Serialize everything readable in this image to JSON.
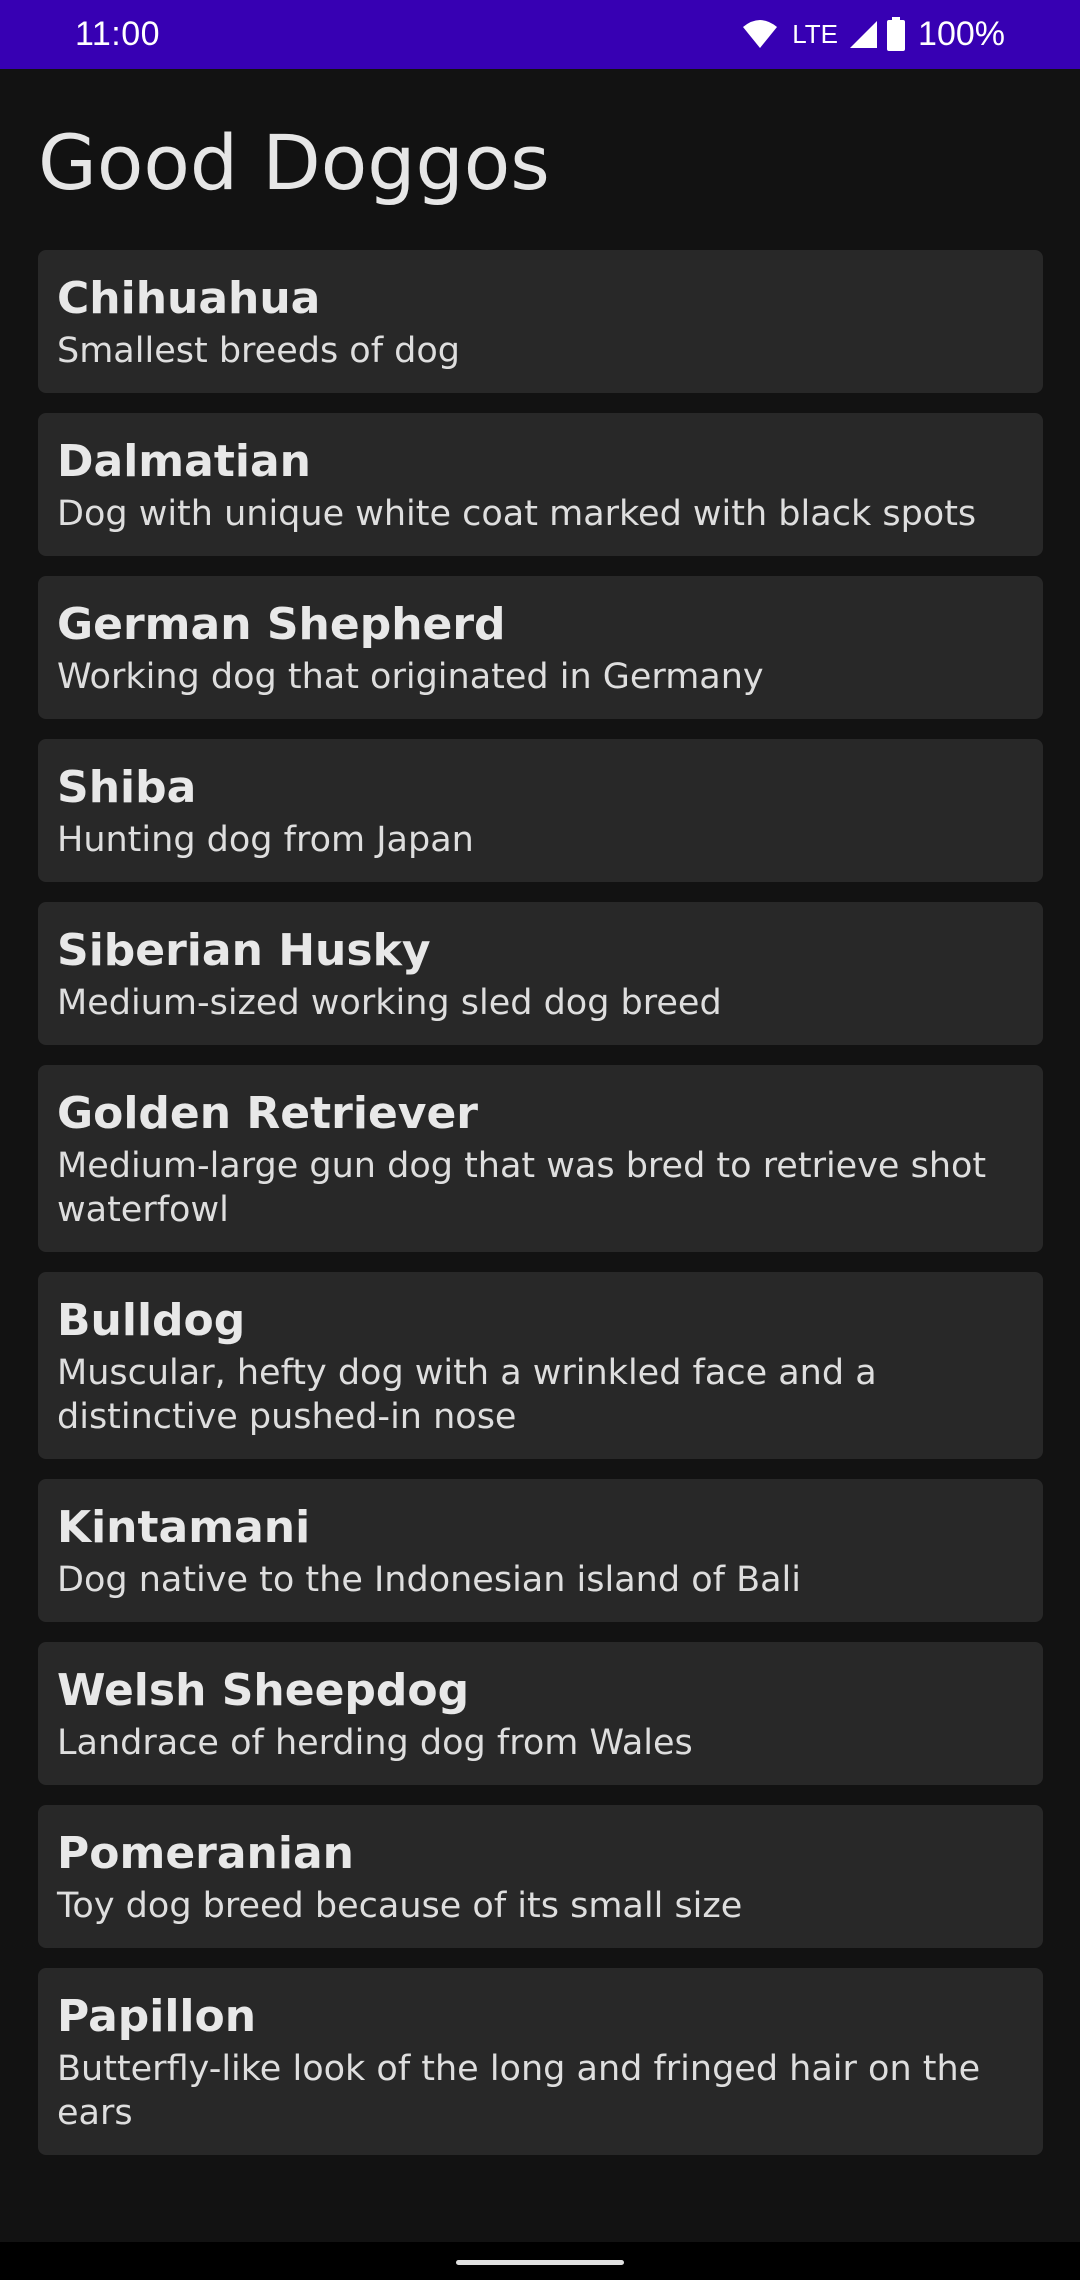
{
  "status_bar": {
    "time": "11:00",
    "network": "LTE",
    "battery": "100%",
    "icons": [
      "wifi-icon",
      "signal-icon",
      "battery-icon"
    ],
    "color": "#3700b3"
  },
  "title": "Good Doggos",
  "dogs": [
    {
      "name": "Chihuahua",
      "description": "Smallest breeds of dog"
    },
    {
      "name": "Dalmatian",
      "description": "Dog with unique white coat marked with black spots"
    },
    {
      "name": "German Shepherd",
      "description": "Working dog that originated in Germany"
    },
    {
      "name": "Shiba",
      "description": "Hunting dog from Japan"
    },
    {
      "name": "Siberian Husky",
      "description": "Medium-sized working sled dog breed"
    },
    {
      "name": "Golden Retriever",
      "description": "Medium-large gun dog that was bred to retrieve shot waterfowl"
    },
    {
      "name": "Bulldog",
      "description": "Muscular, hefty dog with a wrinkled face and a distinctive pushed-in nose"
    },
    {
      "name": "Kintamani",
      "description": "Dog native to the Indonesian island of Bali"
    },
    {
      "name": "Welsh Sheepdog",
      "description": "Landrace of herding dog from Wales"
    },
    {
      "name": "Pomeranian",
      "description": "Toy dog breed because of its small size"
    },
    {
      "name": "Papillon",
      "description": "Butterfly-like look of the long and fringed hair on the ears"
    }
  ],
  "theme": {
    "background": "#121212",
    "card": "#282828",
    "text": "#e8e8e8"
  }
}
